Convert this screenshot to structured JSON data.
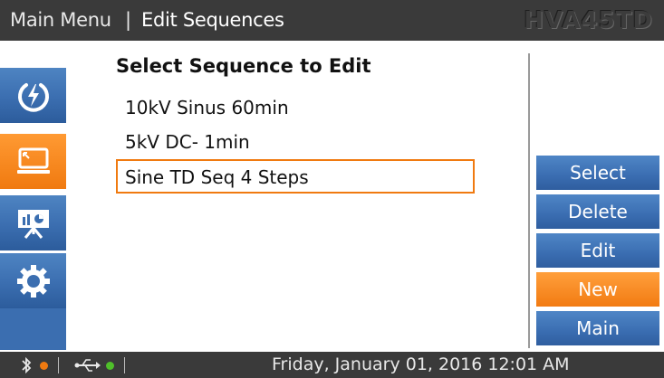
{
  "title_bar": {
    "menu": "Main Menu",
    "separator": "|",
    "page": "Edit Sequences",
    "device": "HVA45TD"
  },
  "sidebar": {
    "items": [
      {
        "icon": "power-bolt-icon",
        "active": false
      },
      {
        "icon": "monitor-icon",
        "active": true
      },
      {
        "icon": "presentation-chart-icon",
        "active": false
      },
      {
        "icon": "gear-icon",
        "active": false
      }
    ]
  },
  "content": {
    "heading": "Select Sequence to Edit",
    "sequences": [
      "10kV Sinus 60min",
      "5kV DC- 1min",
      "Sine TD Seq 4 Steps"
    ],
    "selected_index": 2
  },
  "actions": {
    "select": "Select",
    "delete": "Delete",
    "edit": "Edit",
    "new": "New",
    "main": "Main"
  },
  "status": {
    "bluetooth_icon": "bluetooth-icon",
    "usb_icon": "usb-icon",
    "bt_dot_color": "#f07a10",
    "usb_dot_color": "#4fbf2a",
    "datetime": "Friday, January 01, 2016 12:01 AM"
  }
}
